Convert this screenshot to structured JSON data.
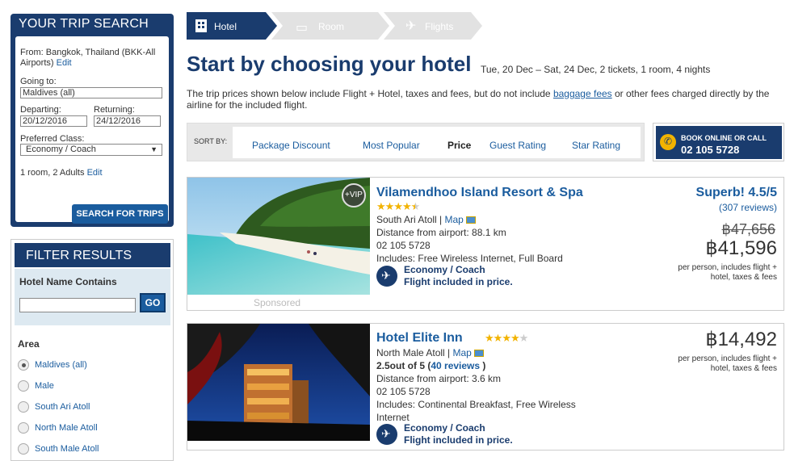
{
  "trip_search": {
    "title": "YOUR TRIP SEARCH",
    "from_label": "From:",
    "from_value_line1": "Bangkok, Thailand (BKK-All",
    "from_value_line2": "Airports)",
    "edit_link": "Edit",
    "going_to_label": "Going to:",
    "going_to_value": "Maldives (all)",
    "departing_label": "Departing:",
    "departing_value": "20/12/2016",
    "returning_label": "Returning:",
    "returning_value": "24/12/2016",
    "class_label": "Preferred Class:",
    "class_value": "Economy / Coach",
    "rooms_text": "1 room, 2 Adults",
    "rooms_edit": "Edit",
    "search_button": "SEARCH FOR TRIPS"
  },
  "filter": {
    "title": "FILTER RESULTS",
    "hotel_name_label": "Hotel Name Contains",
    "hotel_name_value": "",
    "go_button": "GO",
    "area_label": "Area",
    "areas": [
      {
        "label": "Maldives (all)",
        "selected": true
      },
      {
        "label": "Male",
        "selected": false
      },
      {
        "label": "South Ari Atoll",
        "selected": false
      },
      {
        "label": "North Male Atoll",
        "selected": false
      },
      {
        "label": "South Male Atoll",
        "selected": false
      }
    ]
  },
  "steps": [
    {
      "label": "Hotel",
      "active": true
    },
    {
      "label": "Room",
      "active": false
    },
    {
      "label": "Flights",
      "active": false
    }
  ],
  "page": {
    "title": "Start by choosing your hotel",
    "dates": "Tue, 20 Dec – Sat, 24 Dec, 2 tickets, 1 room, 4 nights",
    "note_part1": "The trip prices shown below include Flight + Hotel, taxes and fees, but do not include ",
    "note_link": "baggage fees",
    "note_part2": " or other fees charged directly by the airline for the included flight."
  },
  "sort": {
    "label": "SORT BY:",
    "options": [
      "Package Discount",
      "Most Popular",
      "Price",
      "Guest Rating",
      "Star Rating"
    ],
    "active": "Price"
  },
  "book": {
    "line1": "BOOK ONLINE OR CALL",
    "phone": "02 105 5728"
  },
  "hotels": [
    {
      "name": "Vilamendhoo Island Resort & Spa",
      "stars": 4.5,
      "badge": "+VIP",
      "sponsored": "Sponsored",
      "location": "South Ari Atoll",
      "map_link": "Map",
      "distance": "Distance from airport: 88.1 km",
      "phone": "02 105 5728",
      "includes": "Includes: Free Wireless Internet, Full Board",
      "class": "Economy / Coach",
      "flight_note": "Flight included in price.",
      "rating_text": "Superb! 4.5/5",
      "reviews": "(307 reviews)",
      "old_price": "฿47,656",
      "price": "฿41,596",
      "price_note_1": "per person,  includes flight +",
      "price_note_2": "hotel, taxes & fees"
    },
    {
      "name": "Hotel Elite Inn",
      "stars": 4,
      "location": "North Male Atoll",
      "map_link": "Map",
      "guest_rating": "2.5out of 5 (",
      "guest_reviews": "40 reviews",
      "guest_close": " )",
      "distance": "Distance from airport: 3.6 km",
      "phone": "02 105 5728",
      "includes_1": "Includes: Continental Breakfast, Free Wireless",
      "includes_2": "Internet",
      "class": "Economy / Coach",
      "flight_note": "Flight included in price.",
      "price": "฿14,492",
      "price_note_1": "per person,  includes flight +",
      "price_note_2": "hotel, taxes & fees"
    }
  ],
  "colors": {
    "navy": "#1a3c6e",
    "link": "#1a5c9e",
    "star": "#f2b300"
  }
}
